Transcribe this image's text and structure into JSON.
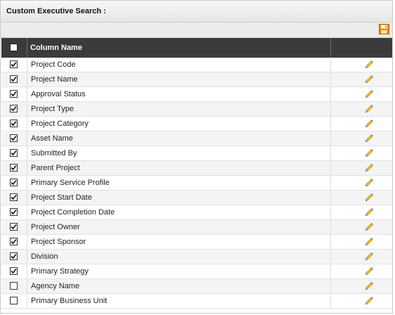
{
  "panel": {
    "title": "Custom Executive Search :"
  },
  "toolbar": {
    "save_icon": "save-icon",
    "save_color": "#f28c00"
  },
  "table": {
    "header": {
      "select_all_checked": false,
      "column_name": "Column Name"
    },
    "rows": [
      {
        "label": "Project Code",
        "checked": true
      },
      {
        "label": "Project Name",
        "checked": true
      },
      {
        "label": "Approval Status",
        "checked": true
      },
      {
        "label": "Project Type",
        "checked": true
      },
      {
        "label": "Project Category",
        "checked": true
      },
      {
        "label": "Asset Name",
        "checked": true
      },
      {
        "label": "Submitted By",
        "checked": true
      },
      {
        "label": "Parent Project",
        "checked": true
      },
      {
        "label": "Primary Service Profile",
        "checked": true
      },
      {
        "label": "Project Start Date",
        "checked": true
      },
      {
        "label": "Project Completion Date",
        "checked": true
      },
      {
        "label": "Project Owner",
        "checked": true
      },
      {
        "label": "Project Sponsor",
        "checked": true
      },
      {
        "label": "Division",
        "checked": true
      },
      {
        "label": "Primary Strategy",
        "checked": true
      },
      {
        "label": "Agency Name",
        "checked": false
      },
      {
        "label": "Primary Business Unit",
        "checked": false
      }
    ],
    "edit_icon": "pencil-icon"
  }
}
